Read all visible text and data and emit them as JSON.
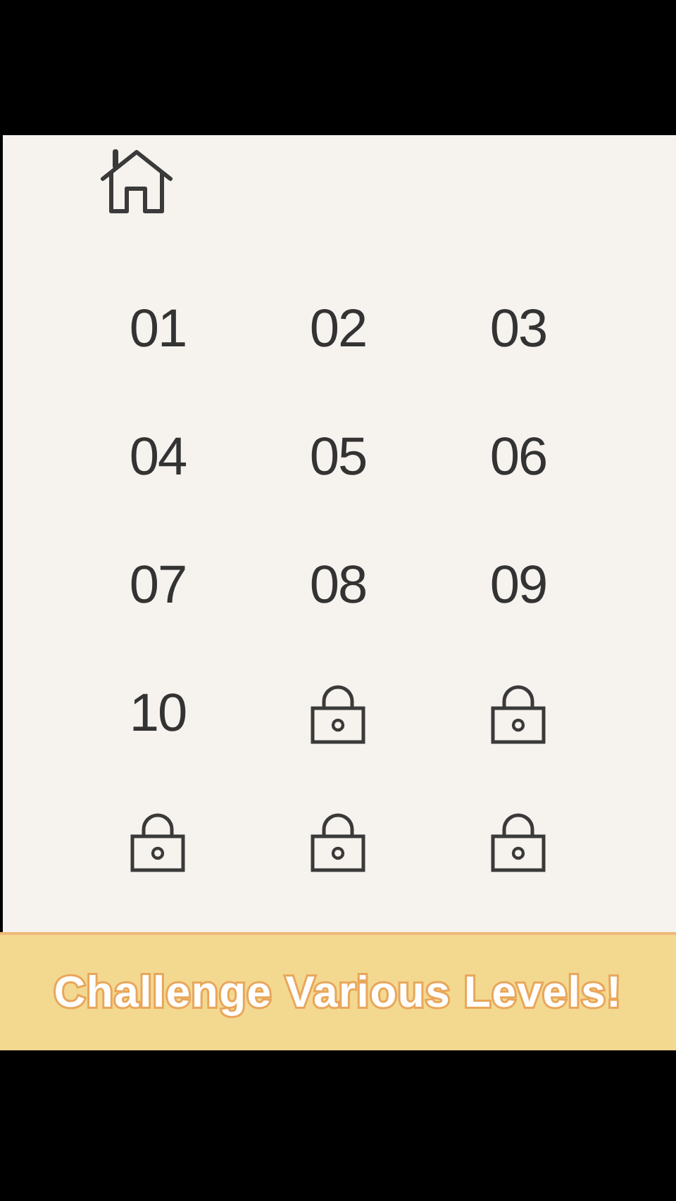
{
  "levels": [
    {
      "label": "01",
      "locked": false
    },
    {
      "label": "02",
      "locked": false
    },
    {
      "label": "03",
      "locked": false
    },
    {
      "label": "04",
      "locked": false
    },
    {
      "label": "05",
      "locked": false
    },
    {
      "label": "06",
      "locked": false
    },
    {
      "label": "07",
      "locked": false
    },
    {
      "label": "08",
      "locked": false
    },
    {
      "label": "09",
      "locked": false
    },
    {
      "label": "10",
      "locked": false
    },
    {
      "locked": true
    },
    {
      "locked": true
    },
    {
      "locked": true
    },
    {
      "locked": true
    },
    {
      "locked": true
    }
  ],
  "banner": {
    "text": "Challenge Various Levels!"
  }
}
